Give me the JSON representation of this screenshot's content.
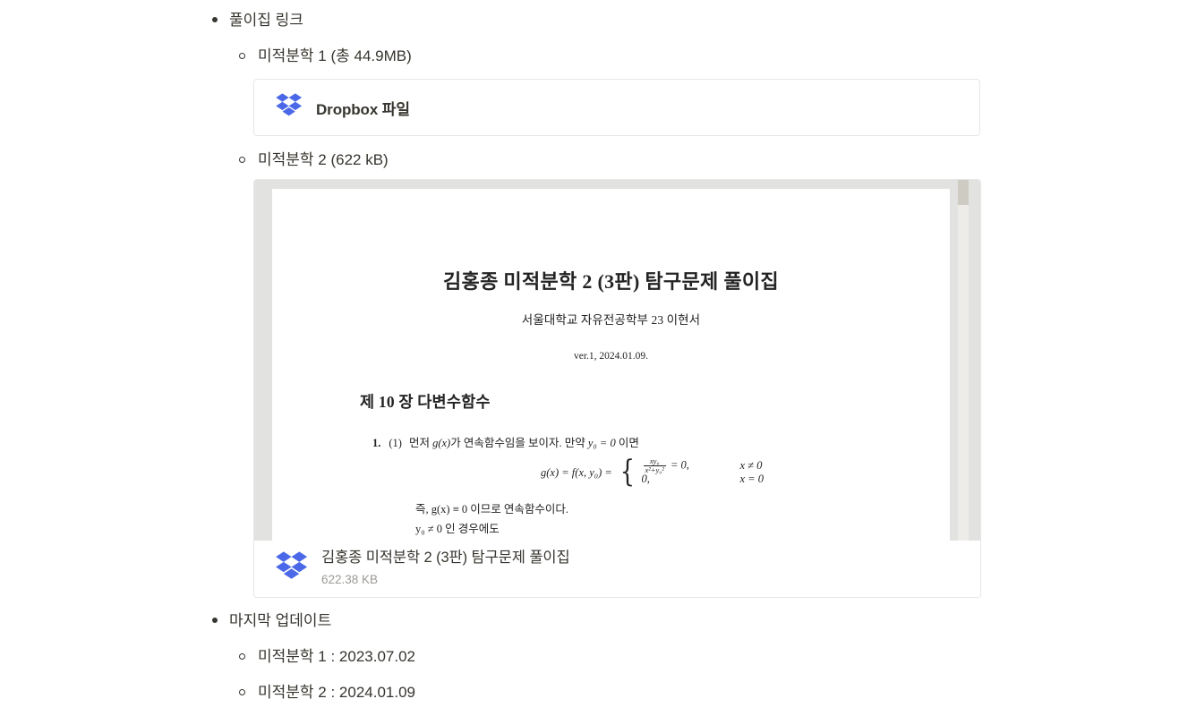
{
  "outline": {
    "section1": {
      "label": "풀이집 링크",
      "items": [
        {
          "label": "미적분학 1 (총 44.9MB)"
        },
        {
          "label": "미적분학 2 (622 kB)"
        }
      ]
    },
    "section2": {
      "label": "마지막 업데이트",
      "items": [
        {
          "label": "미적분학 1 : 2023.07.02"
        },
        {
          "label": "미적분학 2 : 2024.01.09"
        }
      ]
    }
  },
  "embed_simple": {
    "icon": "dropbox-icon",
    "label": "Dropbox 파일",
    "brand_color": "#4a68e8"
  },
  "embed_preview": {
    "icon": "dropbox-icon",
    "file_name": "김홍종 미적분학 2 (3판) 탐구문제 풀이집",
    "file_size": "622.38 KB",
    "brand_color": "#4a68e8",
    "document": {
      "title": "김홍종 미적분학 2 (3판) 탐구문제 풀이집",
      "author": "서울대학교 자유전공학부 23 이현서",
      "version": "ver.1, 2024.01.09.",
      "chapter": "제 10 장 다변수함수",
      "problem_number": "1.",
      "problem_sub": "(1)",
      "problem_text_a": "먼저",
      "problem_func": "g(x)",
      "problem_text_b": "가 연속함수임을 보이자. 만약",
      "problem_cond": "y₀ = 0",
      "problem_text_c": "이면",
      "equation_lhs": "g(x) = f(x, y₀) =",
      "case1_num": "xy₀",
      "case1_den": "x²+y₀²",
      "case1_eq": "= 0,",
      "case1_cond": "x ≠ 0",
      "case2_expr": "0,",
      "case2_cond": "x = 0",
      "conclusion": "즉, g(x) ≡ 0 이므로 연속함수이다.",
      "next_line": "y₀ ≠ 0 인 경우에도"
    }
  }
}
